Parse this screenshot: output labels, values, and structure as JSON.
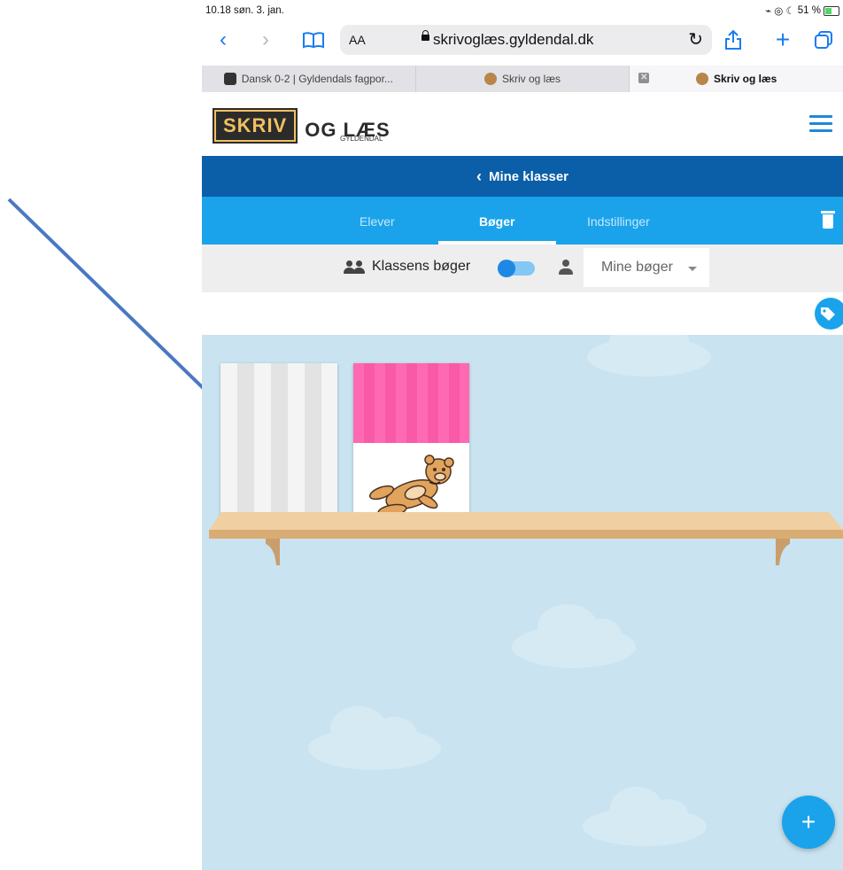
{
  "status_bar": {
    "time": "10.18  søn. 3. jan.",
    "indicators": "⌁ ◎ ☾",
    "battery": "51 %"
  },
  "browser": {
    "back_icon": "‹",
    "forward_icon": "›",
    "bookmarks_icon": "book-icon",
    "aa_label": "AA",
    "url": "skrivoglæs.gyldendal.dk",
    "reload_icon": "↻",
    "share_icon": "share-icon",
    "new_tab_icon": "+",
    "tabs_icon": "tabs-icon",
    "tabs": [
      {
        "label": "Dansk 0-2 | Gyldendals fagpor...",
        "active": false
      },
      {
        "label": "Skriv og læs",
        "active": false
      },
      {
        "label": "Skriv og læs",
        "active": true
      }
    ]
  },
  "site": {
    "logo_skriv": "SKRIV",
    "logo_rest": "OG LÆS",
    "logo_sub": "GYLDENDAL",
    "back_link": "Mine klasser",
    "tabs": [
      {
        "label": "Elever",
        "active": false
      },
      {
        "label": "Bøger",
        "active": true
      },
      {
        "label": "Indstillinger",
        "active": false
      }
    ],
    "filter": {
      "class_books_label": "Klassens bøger",
      "toggle_on": true,
      "my_books_select": "Mine bøger"
    },
    "fab_label": "+"
  },
  "colors": {
    "nav_dark": "#0b5ea8",
    "nav_light": "#1aa3eb",
    "shelf_bg": "#c9e3f0",
    "annotation_arrow": "#4a78c2"
  }
}
